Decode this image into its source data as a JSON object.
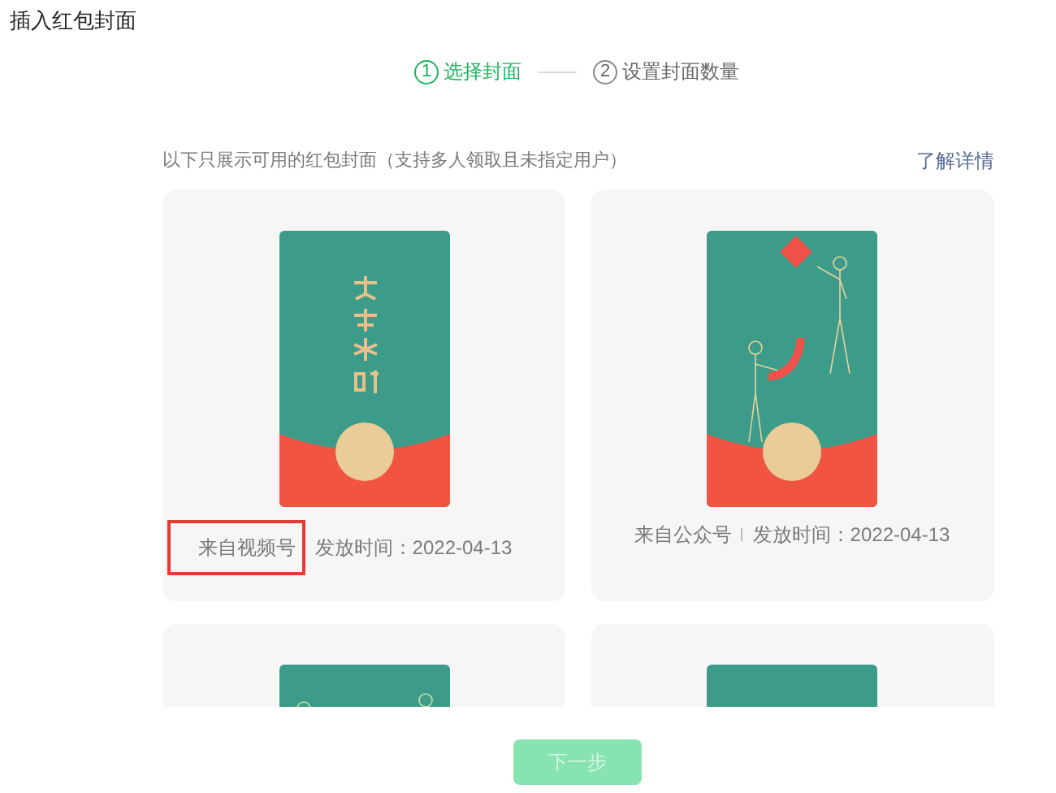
{
  "title": "插入红包封面",
  "steps": [
    {
      "number": "1",
      "label": "选择封面",
      "selected": true
    },
    {
      "number": "2",
      "label": "设置封面数量",
      "selected": false
    }
  ],
  "hint": "以下只展示可用的红包封面（支持多人领取且未指定用户）",
  "details_link": "了解详情",
  "covers": [
    {
      "kind": "calligraphy",
      "source": "来自视频号",
      "date": "发放时间：2022-04-13",
      "highlighted": true
    },
    {
      "kind": "figures",
      "source": "来自公众号",
      "date": "发放时间：2022-04-13",
      "highlighted": false
    },
    {
      "kind": "rings"
    },
    {
      "kind": "plain"
    }
  ],
  "next_button": {
    "label": "下一步",
    "disabled": true
  }
}
